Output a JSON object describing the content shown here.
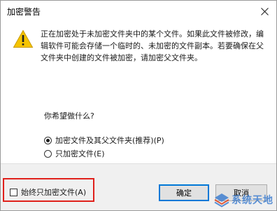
{
  "window": {
    "title": "加密警告"
  },
  "message": "正在加密处于未加密文件夹中的某个文件。如果此文件被修改，编辑软件可能会存储一个临时的、未加密的文件副本。若要确保在父文件夹中创建的文件被加密，请加密父文件夹。",
  "question": "你希望做什么?",
  "options": [
    {
      "label": "加密文件及其父文件夹(推荐)(P)",
      "checked": true
    },
    {
      "label": "只加密文件(E)",
      "checked": false
    }
  ],
  "always_option": {
    "label": "始终只加密文件(A)",
    "checked": false
  },
  "buttons": {
    "ok": "确定",
    "cancel": "取消"
  },
  "watermark": {
    "text": "系统天地"
  },
  "colors": {
    "highlight_box": "#e0201b",
    "warning": "#f5c400",
    "accent": "#0078d7"
  }
}
